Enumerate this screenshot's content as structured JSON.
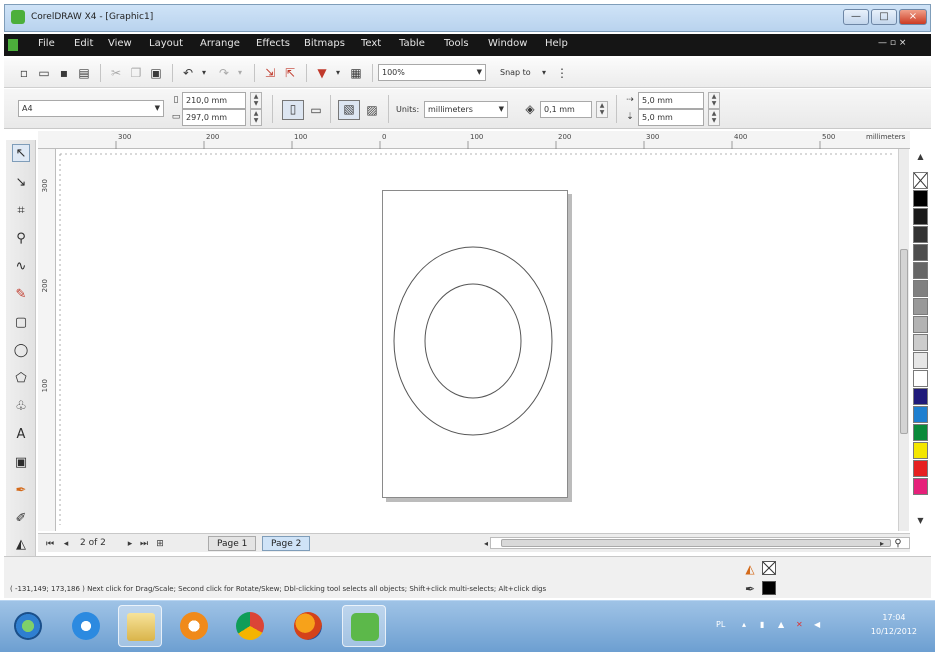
{
  "window": {
    "title": "CorelDRAW X4 - [Graphic1]",
    "controls": {
      "minimize": "—",
      "maximize": "□",
      "close": "×"
    }
  },
  "menu": {
    "items": [
      "File",
      "Edit",
      "View",
      "Layout",
      "Arrange",
      "Effects",
      "Bitmaps",
      "Text",
      "Table",
      "Tools",
      "Window",
      "Help"
    ],
    "doc_controls": "— ▫ ×"
  },
  "toolbar": {
    "zoom_value": "100%",
    "snap_to_label": "Snap to"
  },
  "property_bar": {
    "paper_size": "A4",
    "width": "210,0 mm",
    "height": "297,0 mm",
    "units_label": "Units:",
    "units_value": "millimeters",
    "nudge_value": "0,1 mm",
    "dup_x": "5,0 mm",
    "dup_y": "5,0 mm"
  },
  "ruler": {
    "h_labels": [
      "300",
      "200",
      "100",
      "0",
      "100",
      "200",
      "300",
      "400",
      "500"
    ],
    "h_unit": "millimeters",
    "v_labels": [
      "300",
      "200",
      "100"
    ]
  },
  "page_nav": {
    "page_count": "2 of 2",
    "tabs": [
      "Page 1",
      "Page 2"
    ],
    "active_tab": "Page 2"
  },
  "status": {
    "text": "( -131,149; 173,186 )   Next click for Drag/Scale; Second click for Rotate/Skew; Dbl-clicking tool selects all objects; Shift+click multi-selects; Alt+click digs"
  },
  "palette": {
    "colors": [
      "#ffffff",
      "#000000",
      "#1a1a1a",
      "#333333",
      "#4d4d4d",
      "#666666",
      "#808080",
      "#999999",
      "#b3b3b3",
      "#cccccc",
      "#e6e6e6",
      "#ffffff",
      "#1f1a7a",
      "#1e7fd0",
      "#0a8a3a",
      "#f4e600",
      "#e62020",
      "#e6207a"
    ]
  },
  "taskbar": {
    "clock_time": "17:04",
    "clock_date": "10/12/2012"
  }
}
